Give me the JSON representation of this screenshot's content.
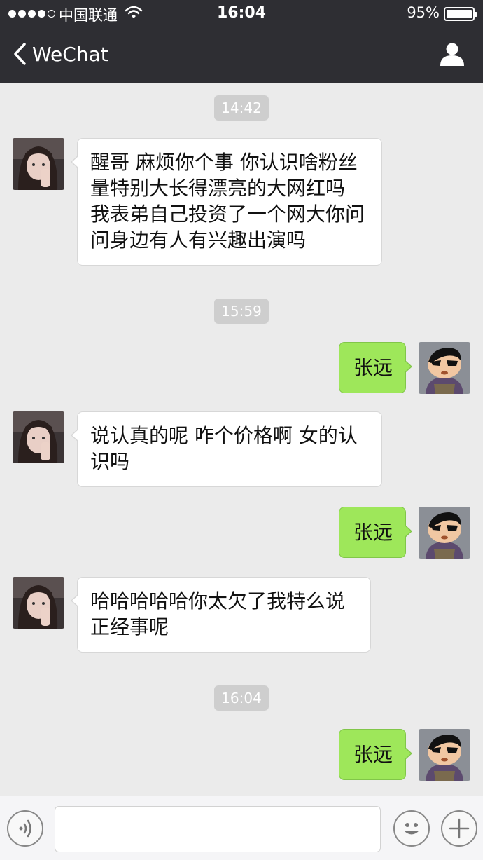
{
  "status_bar": {
    "carrier": "中国联通",
    "time": "16:04",
    "battery": "95%"
  },
  "nav": {
    "back_label": "WeChat"
  },
  "messages": {
    "ts1": "14:42",
    "m1": "醒哥 麻烦你个事 你认识啥粉丝量特别大长得漂亮的大网红吗 我表弟自己投资了一个网大你问问身边有人有兴趣出演吗",
    "ts2": "15:59",
    "m2": "张远",
    "m3": "说认真的呢 咋个价格啊 女的认识吗",
    "m4": "张远",
    "m5": "哈哈哈哈哈你太欠了我特么说正经事呢",
    "ts3": "16:04",
    "m6": "张远"
  },
  "input": {
    "placeholder": ""
  },
  "colors": {
    "header_bg": "#2e2e33",
    "chat_bg": "#ebebeb",
    "outgoing_bubble": "#9ee75a",
    "incoming_bubble": "#ffffff"
  }
}
